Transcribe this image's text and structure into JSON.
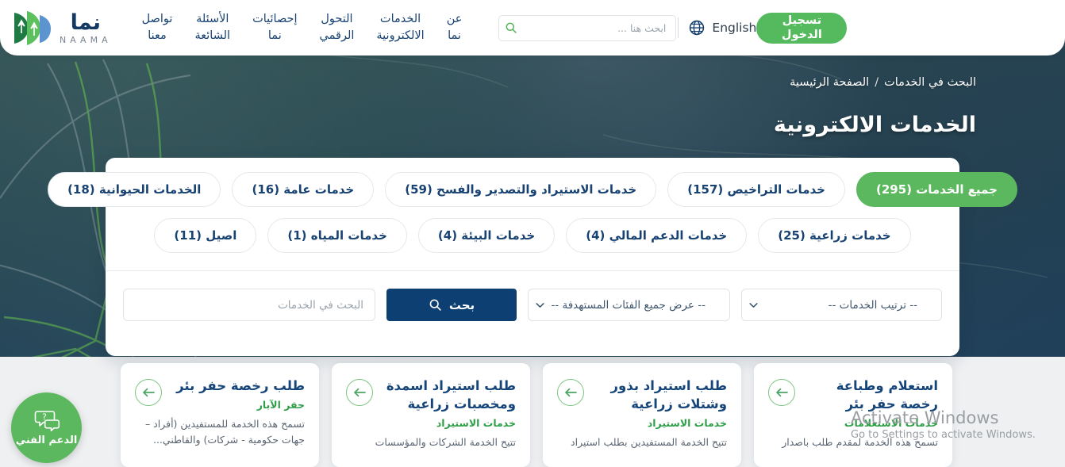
{
  "brand": {
    "arabic": "نما",
    "latin": "NAAMA",
    "logo_icon": "naama-leaf-logo"
  },
  "header": {
    "nav": [
      {
        "label": "عن\nنما",
        "name": "about"
      },
      {
        "label": "الخدمات\nالالكترونية",
        "name": "e-services"
      },
      {
        "label": "التحول\nالرقمي",
        "name": "digital-transformation"
      },
      {
        "label": "إحصائيات\nنما",
        "name": "statistics"
      },
      {
        "label": "الأسئلة\nالشائعة",
        "name": "faq"
      },
      {
        "label": "تواصل\nمعنا",
        "name": "contact"
      }
    ],
    "search_placeholder": "ابحث هنا ...",
    "search_value": "",
    "search_icon": "search-icon",
    "language_label": "English",
    "language_icon": "globe-icon",
    "login_label": "تسجيل\nالدخول"
  },
  "hero": {
    "breadcrumb": {
      "home": "الصفحة الرئيسية",
      "separator": "/",
      "current": "البحث في الخدمات"
    },
    "title": "الخدمات الالكترونية"
  },
  "categories": {
    "row1": [
      {
        "label": "جميع الخدمات (295)",
        "active": true
      },
      {
        "label": "خدمات التراخيص (157)",
        "active": false
      },
      {
        "label": "خدمات الاستيراد والتصدير والفسح (59)",
        "active": false
      },
      {
        "label": "خدمات عامة (16)",
        "active": false
      },
      {
        "label": "الخدمات الحيوانية (18)",
        "active": false
      }
    ],
    "row2": [
      {
        "label": "خدمات زراعية (25)",
        "active": false
      },
      {
        "label": "خدمات الدعم المالي (4)",
        "active": false
      },
      {
        "label": "خدمات البيئة (4)",
        "active": false
      },
      {
        "label": "خدمات المياه (1)",
        "active": false
      },
      {
        "label": "اصيل (11)",
        "active": false
      }
    ]
  },
  "filters": {
    "sort_select": "-- ترتيب الخدمات --",
    "audience_select": "-- عرض جميع الفئات المستهدفة --",
    "search_button": "بحث",
    "search_button_icon": "search-icon",
    "search_placeholder": "البحث في الخدمات",
    "search_value": ""
  },
  "cards": [
    {
      "title": "استعلام وطباعة رخصة حفر بئر",
      "category": "خدمات الاستعلامات",
      "description": "تسمح هذه الخدمة لمقدم طلب باصدار",
      "arrow_icon": "arrow-left-icon"
    },
    {
      "title": "طلب استيراد بذور وشتلات زراعية",
      "category": "خدمات الاستيراد",
      "description": "تتيح الخدمة المستفيدين بطلب استيراد",
      "arrow_icon": "arrow-left-icon"
    },
    {
      "title": "طلب استيراد اسمدة ومخصبات زراعية",
      "category": "خدمات الاستيراد",
      "description": "تتيح الخدمة الشركات والمؤسسات",
      "arrow_icon": "arrow-left-icon"
    },
    {
      "title": "طلب رخصة حفر بئر",
      "category": "حفر الآبار",
      "description": "تسمح هذه الخدمة للمستفيدين (أفراد – جهات حكومية - شركات) والقاطني...",
      "arrow_icon": "arrow-left-icon"
    }
  ],
  "support": {
    "label": "الدعم الفني",
    "icon": "chat-question-icon"
  },
  "watermark": {
    "line1": "Activate Windows",
    "line2": "Go to Settings to activate Windows."
  },
  "colors": {
    "brand_navy": "#143a63",
    "brand_green": "#5cb85f",
    "button_navy": "#0d3f72",
    "category_green": "#2f9e48"
  }
}
